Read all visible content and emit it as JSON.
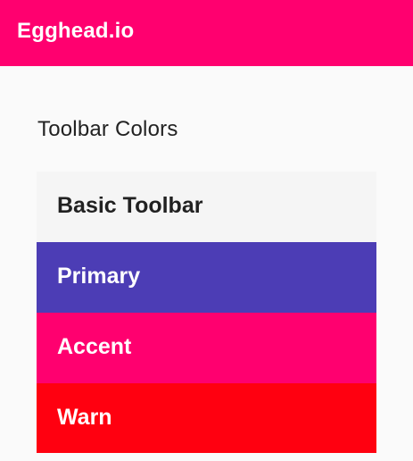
{
  "app_bar": {
    "title": "Egghead.io",
    "color": "#ff006f"
  },
  "section": {
    "title": "Toolbar Colors"
  },
  "toolbars": [
    {
      "label": "Basic Toolbar",
      "background": "#f5f5f5",
      "text_color": "#212121"
    },
    {
      "label": "Primary",
      "background": "#4c3db5",
      "text_color": "#ffffff"
    },
    {
      "label": "Accent",
      "background": "#ff006f",
      "text_color": "#ffffff"
    },
    {
      "label": "Warn",
      "background": "#ff0010",
      "text_color": "#ffffff"
    }
  ]
}
